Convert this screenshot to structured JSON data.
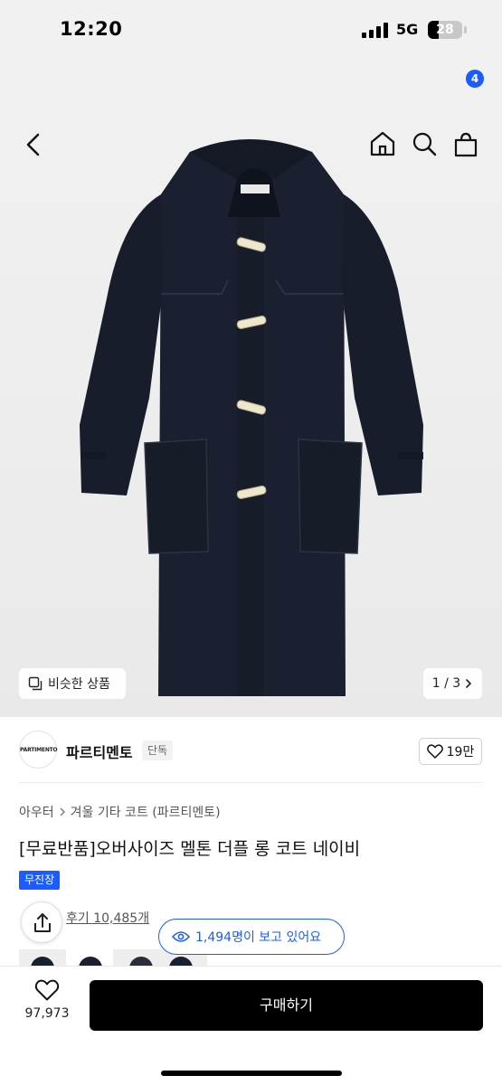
{
  "status": {
    "time": "12:20",
    "network": "5G",
    "battery": "28"
  },
  "nav": {
    "cart_count": "4",
    "icons": [
      "back-icon",
      "home-icon",
      "search-icon",
      "cart-icon"
    ]
  },
  "gallery": {
    "similar_label": "비슷한 상품",
    "page_indicator": "1 / 3"
  },
  "brand": {
    "logo_text": "PARTIMENTO",
    "name": "파르티멘토",
    "tag": "단독",
    "likes": "19만"
  },
  "breadcrumb": {
    "category": "아우터",
    "subcategory": "겨울 기타 코트 (파르티멘토)"
  },
  "product": {
    "title": "[무료반품]오버사이즈 멜톤 더플 롱 코트 네이비",
    "badge": "무진장"
  },
  "reviews": {
    "label": "후기 10,485개"
  },
  "viewers": {
    "label": "1,494명이 보고 있어요"
  },
  "bottom": {
    "wishlist_count": "97,973",
    "buy_label": "구매하기"
  },
  "colors": {
    "accent": "#1a5cff",
    "coat": "#1b2030",
    "toggle": "#efe6cc"
  }
}
